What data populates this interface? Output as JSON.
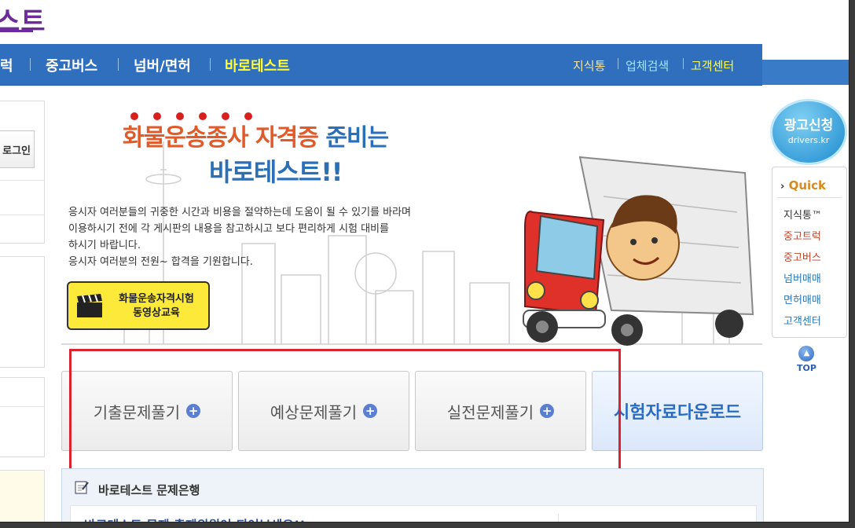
{
  "site": {
    "logo_text": "스트"
  },
  "nav": {
    "items": [
      {
        "label": "럭",
        "active": false
      },
      {
        "label": "중고버스",
        "active": false
      },
      {
        "label": "넘버/면허",
        "active": false
      },
      {
        "label": "바로테스트",
        "active": true
      }
    ],
    "right_links": [
      {
        "label": "지식통",
        "color": "#f6e39b"
      },
      {
        "label": "업체검색",
        "color": "#9fe6ff"
      },
      {
        "label": "고객센터",
        "color": "#ffff55"
      }
    ]
  },
  "sidebar_left": {
    "login_label": "로그인"
  },
  "banner": {
    "headline_part1": "화물운송종사 자격증",
    "headline_part2": "준비는",
    "subheadline": "바로테스트!!",
    "description_lines": [
      "응시자 여러분들의 귀중한 시간과 비용을 절약하는데 도움이 될 수 있기를 바라며",
      "이용하시기  전에 각 게시판의 내용을 참고하시고 보다 편리하게  시험 대비를",
      "하시기 바랍니다.",
      "응시자 여러분의 전원~ 합격을 기원합니다."
    ],
    "video_button": {
      "line1": "화물운송자격시험",
      "line2": "동영상교육"
    }
  },
  "tabs": [
    {
      "label": "기출문제풀기"
    },
    {
      "label": "예상문제풀기"
    },
    {
      "label": "실전문제풀기"
    },
    {
      "label": "시험자료다운로드"
    }
  ],
  "question_bank": {
    "title": "바로테스트 문제은행",
    "link_text": "바로테스트 문제 출제위원이 되어보세요!!"
  },
  "ad": {
    "title": "광고신청",
    "domain": "drivers.kr"
  },
  "quick": {
    "header": "Quick",
    "items": [
      {
        "label": "지식통™",
        "color": "#333333"
      },
      {
        "label": "중고트럭",
        "color": "#c0462a"
      },
      {
        "label": "중고버스",
        "color": "#c0462a"
      },
      {
        "label": "넘버매매",
        "color": "#2a79b5"
      },
      {
        "label": "면허매매",
        "color": "#2a79b5"
      },
      {
        "label": "고객센터",
        "color": "#2a79b5"
      }
    ]
  },
  "top_button": {
    "label": "TOP"
  },
  "colors": {
    "nav_bg": "#2f6fbd",
    "highlight_box": "#d9232e",
    "accent_yellow": "#fde93a"
  }
}
